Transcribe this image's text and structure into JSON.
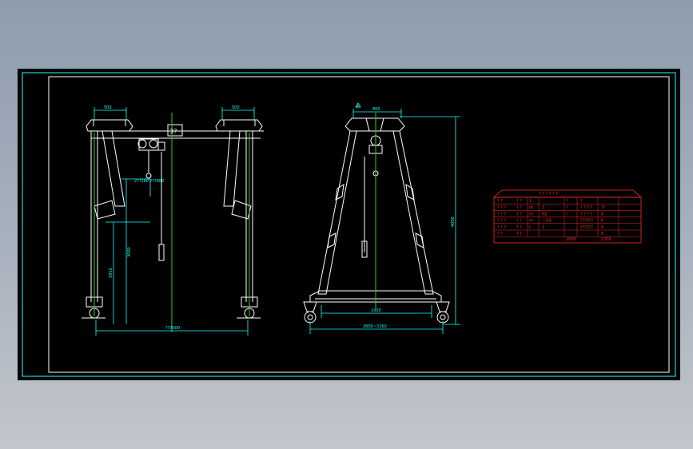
{
  "front_view": {
    "dim_top_left": "500",
    "dim_top_right": "500",
    "beam_tag": "3?",
    "hook_dims": "2??180 ???600",
    "dim_height_inner": "3000",
    "dim_height_outer": "3910",
    "dim_span": "??3000"
  },
  "side_view": {
    "dim_top": "800",
    "dim_marker": "A",
    "dim_height": "4000",
    "dim_base_inner": "1950",
    "dim_base_outer": "2600~3160"
  },
  "spec_table": {
    "title": "? ? ? ? ? ?",
    "rows": [
      [
        "? ?",
        "? ?",
        "1",
        "",
        "?",
        "?",
        ""
      ],
      [
        "? ? ?",
        "? ?",
        "m",
        "3",
        "?",
        "? ? ? ?",
        "??"
      ],
      [
        "? ? ?",
        "? ?",
        "m",
        "65",
        "?",
        "? ? ? ?",
        "6"
      ],
      [
        "? ? ?",
        "? ?",
        "m",
        "~3.6",
        "",
        "??????",
        "6"
      ],
      [
        "? ? ?",
        "? ?",
        "t",
        "2",
        "",
        "??????",
        "6"
      ],
      [
        "? ?",
        "? ?",
        "",
        "",
        "",
        "",
        "5"
      ]
    ],
    "footer_left": "2000",
    "footer_right": "1200"
  },
  "colors": {
    "background": "#000000",
    "frame": "#19ffff",
    "border": "#ffffff",
    "table": "#ff2a2a",
    "structure": "#ffffff",
    "centerline": "#22d522"
  }
}
